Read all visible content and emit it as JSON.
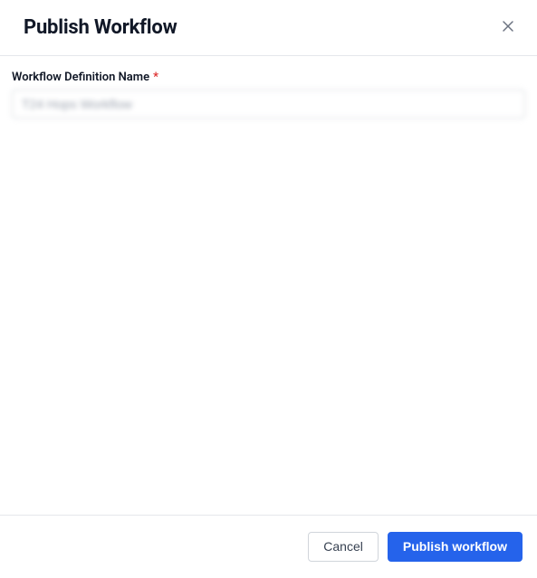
{
  "header": {
    "title": "Publish Workflow"
  },
  "form": {
    "name_label": "Workflow Definition Name",
    "required_marker": "*",
    "name_value": "T24 Hops Workflow"
  },
  "footer": {
    "cancel_label": "Cancel",
    "publish_label": "Publish workflow"
  }
}
